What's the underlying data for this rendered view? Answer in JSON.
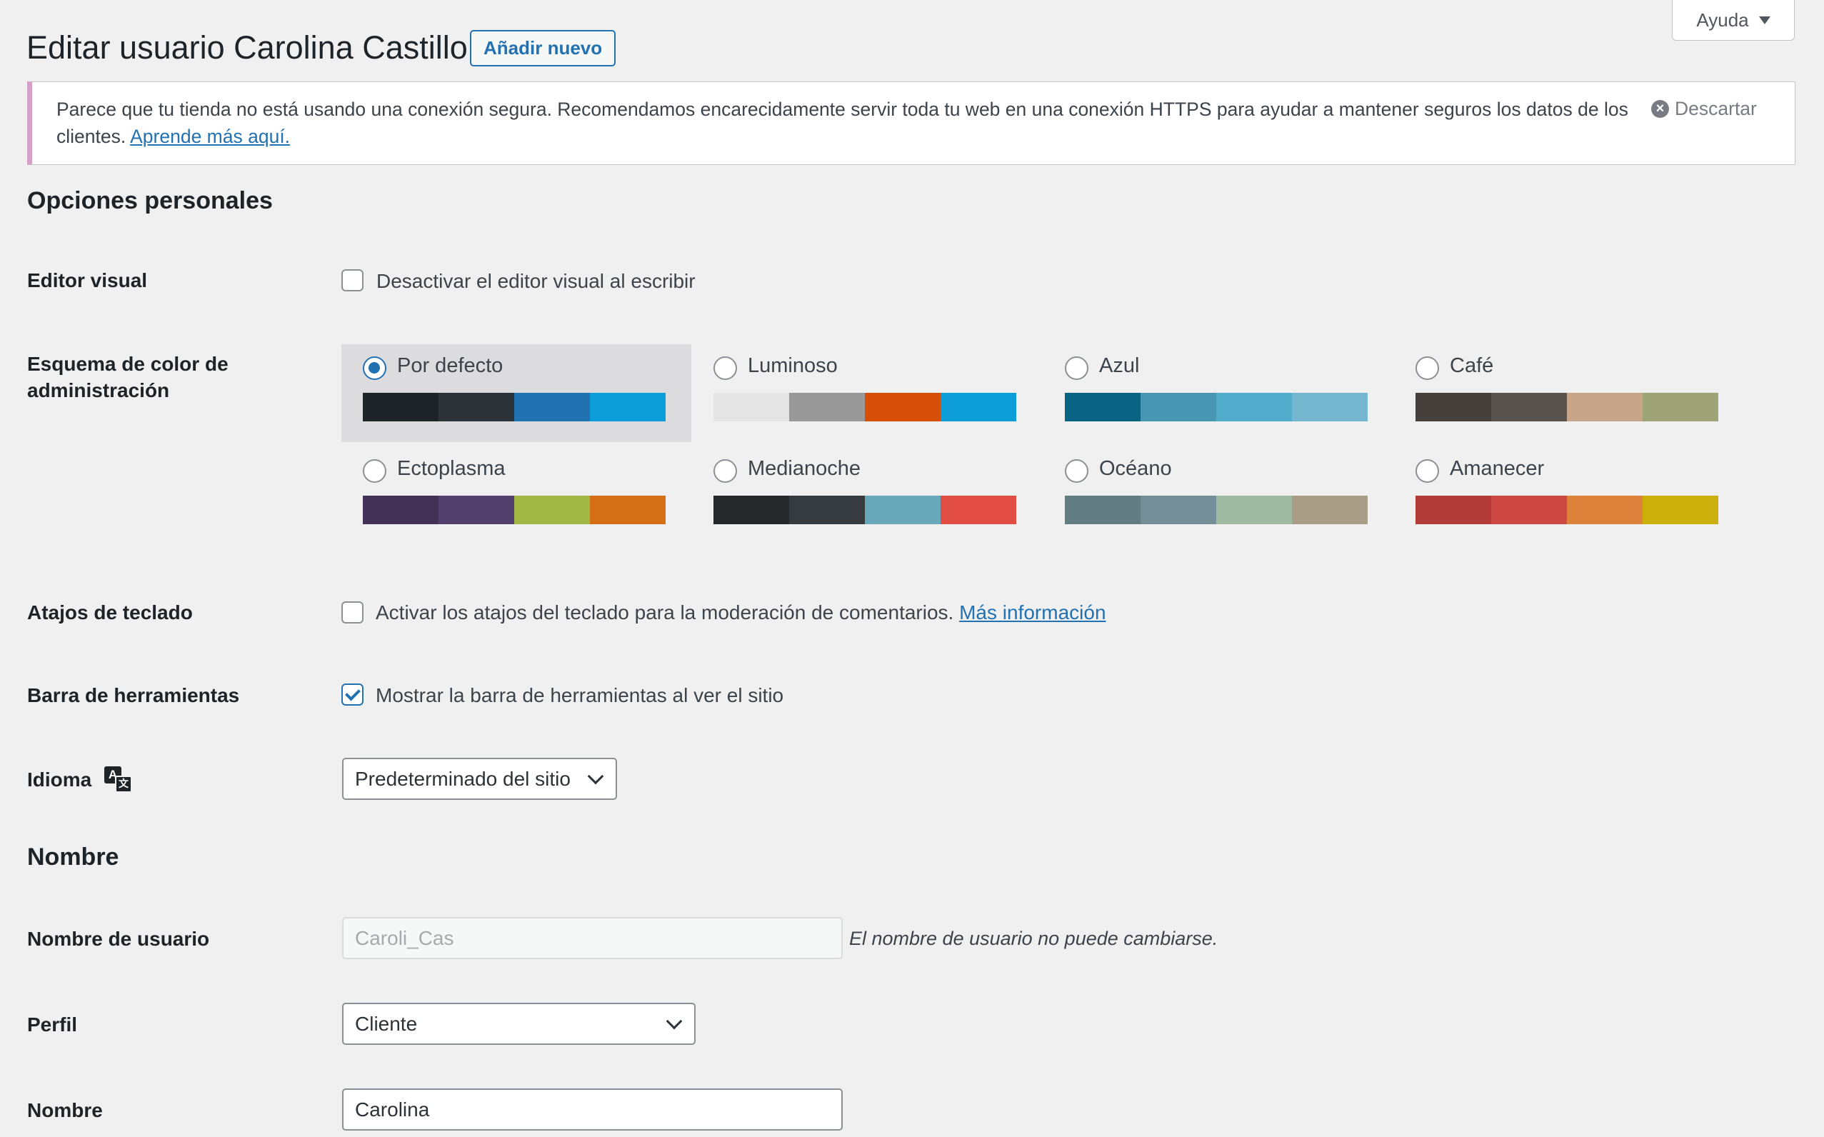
{
  "help_tab": {
    "label": "Ayuda"
  },
  "header": {
    "title": "Editar usuario Carolina Castillo",
    "add_new": "Añadir nuevo"
  },
  "notice": {
    "text": "Parece que tu tienda no está usando una conexión segura. Recomendamos encarecidamente servir toda tu web en una conexión HTTPS para ayudar a mantener seguros los datos de los clientes.",
    "link": "Aprende más aquí.",
    "dismiss": "Descartar"
  },
  "personal": {
    "heading": "Opciones personales",
    "visual_editor": {
      "label": "Editor visual",
      "checkbox": "Desactivar el editor visual al escribir",
      "checked": false
    },
    "color_scheme": {
      "label": "Esquema de color de administración",
      "selected": "Por defecto",
      "schemes": [
        {
          "name": "Por defecto",
          "colors": [
            "#1d2327",
            "#2c3338",
            "#2271b1",
            "#0d9dd8"
          ]
        },
        {
          "name": "Luminoso",
          "colors": [
            "#e5e5e5",
            "#999999",
            "#d64e07",
            "#0d9dd8"
          ]
        },
        {
          "name": "Azul",
          "colors": [
            "#096484",
            "#4796b3",
            "#52accc",
            "#74b6ce"
          ]
        },
        {
          "name": "Café",
          "colors": [
            "#46403c",
            "#59524c",
            "#c7a589",
            "#9ea476"
          ]
        },
        {
          "name": "Ectoplasma",
          "colors": [
            "#413256",
            "#523f6d",
            "#a3b745",
            "#d46f15"
          ]
        },
        {
          "name": "Medianoche",
          "colors": [
            "#25282b",
            "#363b3f",
            "#69a8bb",
            "#e14d43"
          ]
        },
        {
          "name": "Océano",
          "colors": [
            "#627c83",
            "#738e96",
            "#9ebaa0",
            "#aa9d88"
          ]
        },
        {
          "name": "Amanecer",
          "colors": [
            "#b43c38",
            "#cf4944",
            "#dd823b",
            "#ccaf0b"
          ]
        }
      ]
    },
    "keyboard": {
      "label": "Atajos de teclado",
      "checkbox": "Activar los atajos del teclado para la moderación de comentarios.",
      "link": "Más información",
      "checked": false
    },
    "toolbar": {
      "label": "Barra de herramientas",
      "checkbox": "Mostrar la barra de herramientas al ver el sitio",
      "checked": true
    },
    "language": {
      "label": "Idioma",
      "value": "Predeterminado del sitio"
    }
  },
  "name_section": {
    "heading": "Nombre",
    "username": {
      "label": "Nombre de usuario",
      "value": "Caroli_Cas",
      "description": "El nombre de usuario no puede cambiarse."
    },
    "role": {
      "label": "Perfil",
      "value": "Cliente"
    },
    "first_name": {
      "label": "Nombre",
      "value": "Carolina"
    }
  }
}
